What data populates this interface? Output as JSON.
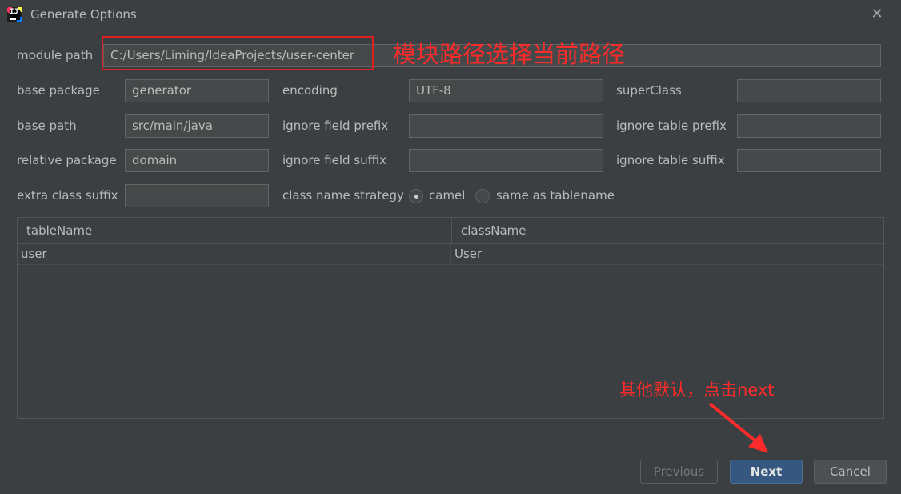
{
  "window": {
    "title": "Generate Options",
    "close_icon": "close-icon"
  },
  "form": {
    "module_path_label": "module path",
    "module_path_value": "C:/Users/Liming/IdeaProjects/user-center",
    "base_package_label": "base package",
    "base_package_value": "generator",
    "encoding_label": "encoding",
    "encoding_value": "UTF-8",
    "super_class_label": "superClass",
    "super_class_value": "",
    "base_path_label": "base path",
    "base_path_value": "src/main/java",
    "ignore_field_prefix_label": "ignore field prefix",
    "ignore_field_prefix_value": "",
    "ignore_table_prefix_label": "ignore table prefix",
    "ignore_table_prefix_value": "",
    "relative_package_label": "relative package",
    "relative_package_value": "domain",
    "ignore_field_suffix_label": "ignore field suffix",
    "ignore_field_suffix_value": "",
    "ignore_table_suffix_label": "ignore table suffix",
    "ignore_table_suffix_value": "",
    "extra_class_suffix_label": "extra class suffix",
    "extra_class_suffix_value": "",
    "class_name_strategy_label": "class name strategy",
    "strategy_option_camel": "camel",
    "strategy_option_same": "same as tablename",
    "strategy_selected": "camel"
  },
  "table": {
    "headers": [
      "tableName",
      "className"
    ],
    "rows": [
      [
        "user",
        "User"
      ]
    ]
  },
  "buttons": {
    "previous": "Previous",
    "next": "Next",
    "cancel": "Cancel"
  },
  "annotations": {
    "module_path_note": "模块路径选择当前路径",
    "next_note": "其他默认，点击next",
    "color": "#ff2a2a"
  }
}
